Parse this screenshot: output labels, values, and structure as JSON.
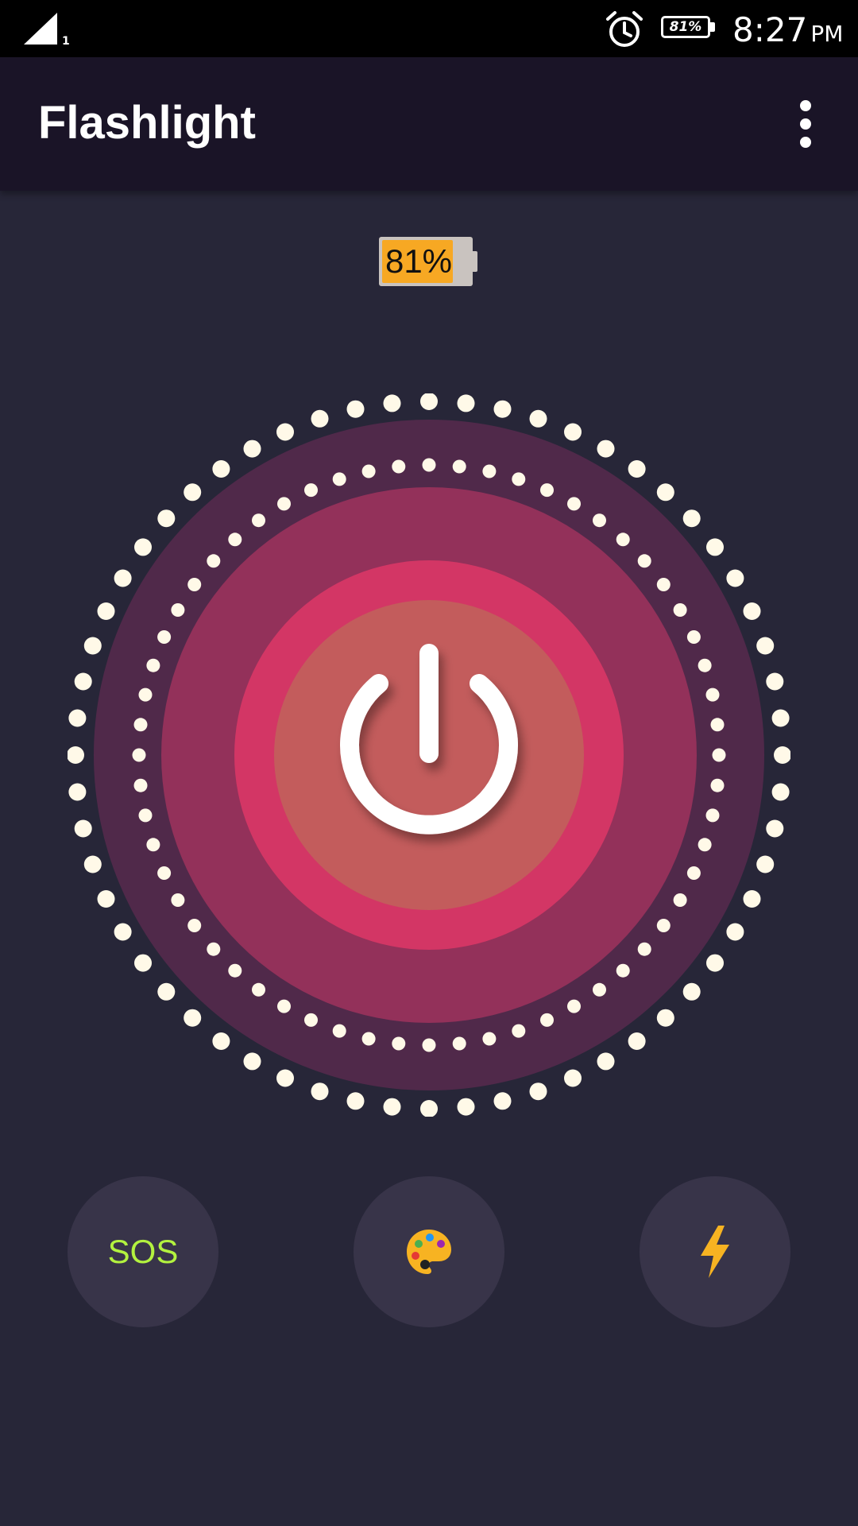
{
  "status_bar": {
    "signal_sub": "1",
    "battery_text": "81%",
    "time": "8:27",
    "ampm": "PM",
    "icons": [
      "signal-icon",
      "alarm-icon",
      "battery-icon"
    ]
  },
  "app_bar": {
    "title": "Flashlight",
    "menu_icon": "more-vert-icon"
  },
  "battery_indicator": {
    "label": "81%",
    "level": 0.81,
    "fill_color": "#f7a823"
  },
  "power_button": {
    "icon": "power-icon",
    "colors": {
      "outer_ring": "#50294a",
      "middle_ring": "#93315a",
      "inner_ring": "#d33665",
      "core": "#c35c5c",
      "dots": "#fff9e8"
    }
  },
  "controls": {
    "sos_label": "SOS",
    "sos_color": "#b3f23f",
    "color_icon": "palette-icon",
    "strobe_icon": "lightning-icon",
    "accent": "#f7b322"
  }
}
